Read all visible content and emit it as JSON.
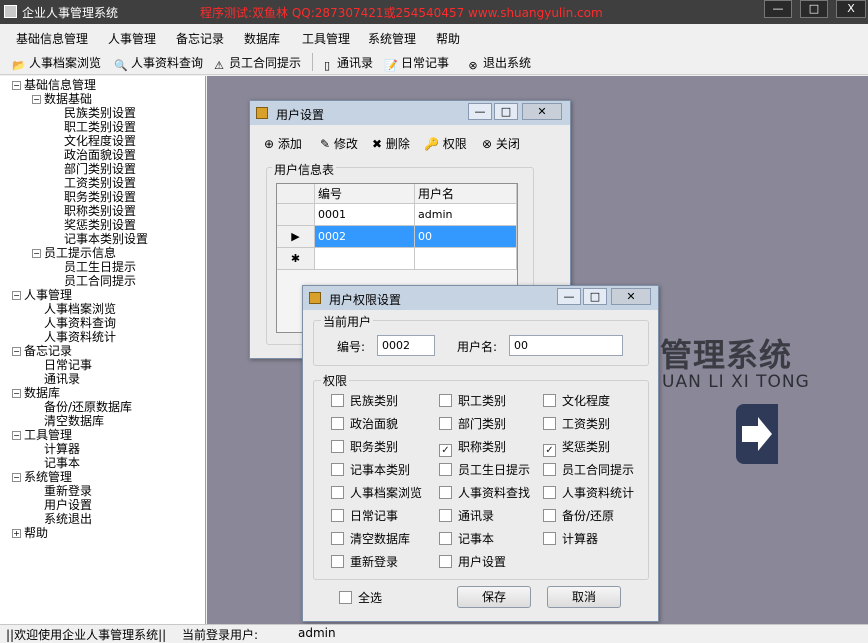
{
  "app": {
    "title": "企业人事管理系统",
    "watermark_info": "程序测试:双鱼林 QQ:287307421或254540457 www.shuangyulin.com",
    "window_buttons": [
      "—",
      "□",
      "X"
    ]
  },
  "menu": [
    "基础信息管理",
    "人事管理",
    "备忘记录",
    "数据库",
    "工具管理",
    "系统管理",
    "帮助"
  ],
  "toolbar": [
    {
      "label": "人事档案浏览",
      "icon": "folder-open-icon"
    },
    {
      "label": "人事资料查询",
      "icon": "search-icon"
    },
    {
      "label": "员工合同提示",
      "icon": "warning-icon"
    },
    {
      "label": "通讯录",
      "icon": "phone-book-icon"
    },
    {
      "label": "日常记事",
      "icon": "notepad-icon"
    },
    {
      "label": "退出系统",
      "icon": "exit-icon"
    }
  ],
  "tree": [
    {
      "label": "基础信息管理",
      "level": 0,
      "toggle": "−"
    },
    {
      "label": "数据基础",
      "level": 1,
      "toggle": "−"
    },
    {
      "label": "民族类别设置",
      "level": 2
    },
    {
      "label": "职工类别设置",
      "level": 2
    },
    {
      "label": "文化程度设置",
      "level": 2
    },
    {
      "label": "政治面貌设置",
      "level": 2
    },
    {
      "label": "部门类别设置",
      "level": 2
    },
    {
      "label": "工资类别设置",
      "level": 2
    },
    {
      "label": "职务类别设置",
      "level": 2
    },
    {
      "label": "职称类别设置",
      "level": 2
    },
    {
      "label": "奖惩类别设置",
      "level": 2
    },
    {
      "label": "记事本类别设置",
      "level": 2
    },
    {
      "label": "员工提示信息",
      "level": 1,
      "toggle": "−"
    },
    {
      "label": "员工生日提示",
      "level": 2
    },
    {
      "label": "员工合同提示",
      "level": 2
    },
    {
      "label": "人事管理",
      "level": 0,
      "toggle": "−"
    },
    {
      "label": "人事档案浏览",
      "level": 1
    },
    {
      "label": "人事资料查询",
      "level": 1
    },
    {
      "label": "人事资料统计",
      "level": 1
    },
    {
      "label": "备忘记录",
      "level": 0,
      "toggle": "−"
    },
    {
      "label": "日常记事",
      "level": 1
    },
    {
      "label": "通讯录",
      "level": 1
    },
    {
      "label": "数据库",
      "level": 0,
      "toggle": "−"
    },
    {
      "label": "备份/还原数据库",
      "level": 1
    },
    {
      "label": "清空数据库",
      "level": 1
    },
    {
      "label": "工具管理",
      "level": 0,
      "toggle": "−"
    },
    {
      "label": "计算器",
      "level": 1
    },
    {
      "label": "记事本",
      "level": 1
    },
    {
      "label": "系统管理",
      "level": 0,
      "toggle": "−"
    },
    {
      "label": "重新登录",
      "level": 1
    },
    {
      "label": "用户设置",
      "level": 1
    },
    {
      "label": "系统退出",
      "level": 1
    },
    {
      "label": "帮助",
      "level": 0,
      "toggle": "+"
    }
  ],
  "background": {
    "brand": "管理系统",
    "brand_pinyin": "UAN LI XI TONG"
  },
  "user_settings": {
    "title": "用户设置",
    "toolbar": [
      {
        "label": "添加",
        "icon": "add-icon"
      },
      {
        "label": "修改",
        "icon": "edit-icon"
      },
      {
        "label": "删除",
        "icon": "delete-icon"
      },
      {
        "label": "权限",
        "icon": "permission-icon"
      },
      {
        "label": "关闭",
        "icon": "close-icon"
      }
    ],
    "group_label": "用户信息表",
    "columns": [
      "编号",
      "用户名"
    ],
    "rows": [
      {
        "id": "0001",
        "name": "admin",
        "marker": ""
      },
      {
        "id": "0002",
        "name": "00",
        "marker": "▶"
      },
      {
        "id": "",
        "name": "",
        "marker": "✱"
      }
    ]
  },
  "permission_dialog": {
    "title": "用户权限设置",
    "current_user_label": "当前用户",
    "id_label": "编号:",
    "id_value": "0002",
    "name_label": "用户名:",
    "name_value": "00",
    "perm_label": "权限",
    "permissions": [
      {
        "label": "民族类别",
        "checked": false
      },
      {
        "label": "职工类别",
        "checked": false
      },
      {
        "label": "文化程度",
        "checked": false
      },
      {
        "label": "政治面貌",
        "checked": false
      },
      {
        "label": "部门类别",
        "checked": false
      },
      {
        "label": "工资类别",
        "checked": false
      },
      {
        "label": "职务类别",
        "checked": false
      },
      {
        "label": "职称类别",
        "checked": true
      },
      {
        "label": "奖惩类别",
        "checked": true
      },
      {
        "label": "记事本类别",
        "checked": false
      },
      {
        "label": "员工生日提示",
        "checked": false
      },
      {
        "label": "员工合同提示",
        "checked": false
      },
      {
        "label": "人事档案浏览",
        "checked": false
      },
      {
        "label": "人事资料查找",
        "checked": false
      },
      {
        "label": "人事资料统计",
        "checked": false
      },
      {
        "label": "日常记事",
        "checked": false
      },
      {
        "label": "通讯录",
        "checked": false
      },
      {
        "label": "备份/还原",
        "checked": false
      },
      {
        "label": "清空数据库",
        "checked": false
      },
      {
        "label": "记事本",
        "checked": false
      },
      {
        "label": "计算器",
        "checked": false
      },
      {
        "label": "重新登录",
        "checked": false
      },
      {
        "label": "用户设置",
        "checked": false
      }
    ],
    "select_all": "全选",
    "save": "保存",
    "cancel": "取消"
  },
  "status": {
    "welcome": "||欢迎使用企业人事管理系统||",
    "current_user_label": "当前登录用户:",
    "current_user": "admin"
  }
}
